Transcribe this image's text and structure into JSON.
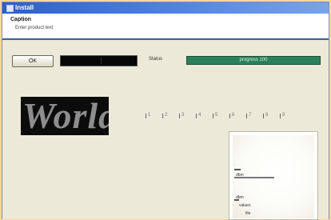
{
  "window": {
    "title": "Install",
    "header": {
      "caption": "Caption",
      "subcaption": "Enter product text"
    }
  },
  "toolbar": {
    "button_label": "OK",
    "field_label": "Status",
    "progress_text": "progress 100",
    "progress_value": 1.0
  },
  "logo": {
    "text": "World"
  },
  "ruler": {
    "marks": [
      "1",
      "2",
      "3",
      "4",
      "5",
      "6",
      "7",
      "8",
      "9"
    ]
  },
  "preview": {
    "labels": [
      "",
      "dbm",
      "",
      "dbm",
      "values",
      "file"
    ]
  },
  "colors": {
    "background": "#f6d998",
    "window": "#ece9d8",
    "titlebar": "#2e5fc8",
    "accent_line": "#3d61b4",
    "progress": "#1f6b4a"
  }
}
